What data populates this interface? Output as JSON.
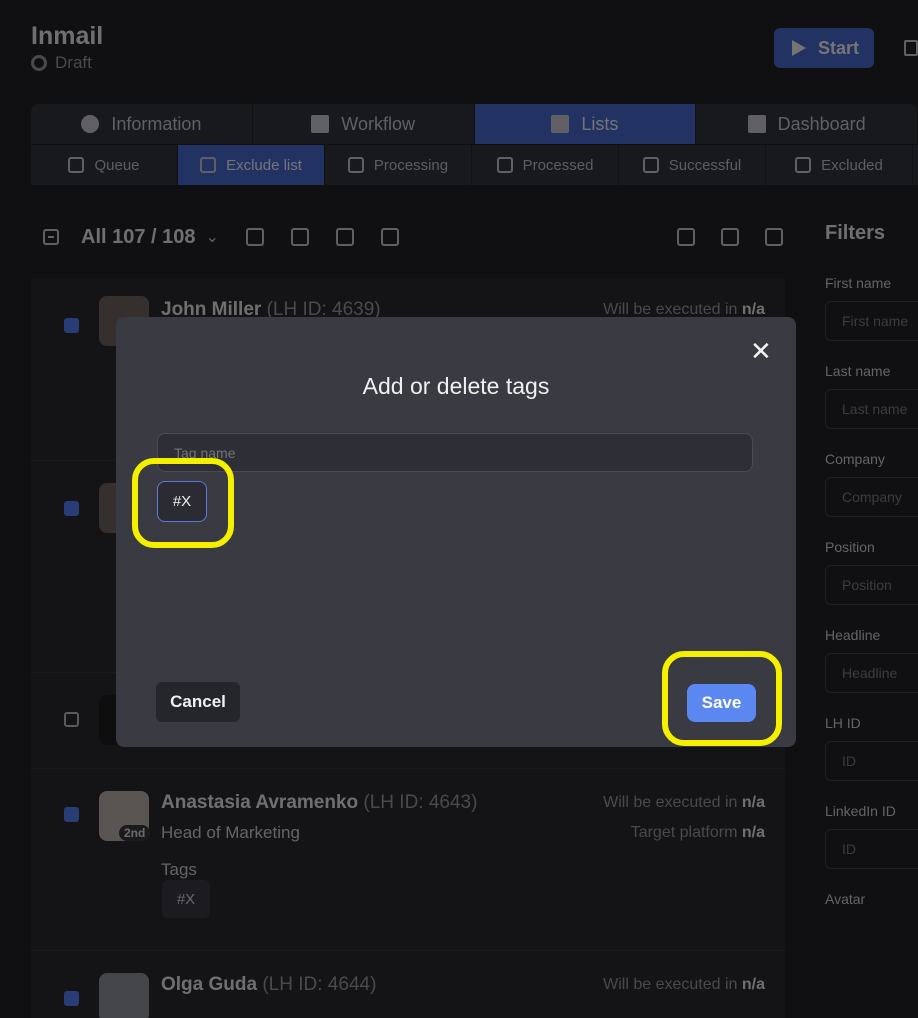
{
  "header": {
    "title": "Inmail",
    "status": "Draft",
    "start_label": "Start"
  },
  "tabs": [
    {
      "label": "Information",
      "icon": "info-icon",
      "active": false
    },
    {
      "label": "Workflow",
      "icon": "workflow-icon",
      "active": false
    },
    {
      "label": "Lists",
      "icon": "list-icon",
      "active": true
    },
    {
      "label": "Dashboard",
      "icon": "dashboard-icon",
      "active": false
    }
  ],
  "subtabs": [
    {
      "label": "Queue",
      "icon": "queue-icon",
      "active": false
    },
    {
      "label": "Exclude list",
      "icon": "ban-icon",
      "active": true
    },
    {
      "label": "Processing",
      "icon": "refresh-icon",
      "active": false
    },
    {
      "label": "Processed",
      "icon": "flag-icon",
      "active": false
    },
    {
      "label": "Successful",
      "icon": "check-icon",
      "active": false
    },
    {
      "label": "Excluded",
      "icon": "user-x-icon",
      "active": false
    }
  ],
  "toolbar": {
    "count_label": "All 107 / 108"
  },
  "filters": {
    "title": "Filters",
    "fields": [
      {
        "label": "First name",
        "placeholder": "First name"
      },
      {
        "label": "Last name",
        "placeholder": "Last name"
      },
      {
        "label": "Company",
        "placeholder": "Company"
      },
      {
        "label": "Position",
        "placeholder": "Position"
      },
      {
        "label": "Headline",
        "placeholder": "Headline"
      },
      {
        "label": "LH ID",
        "placeholder": "ID"
      },
      {
        "label": "LinkedIn ID",
        "placeholder": "ID"
      },
      {
        "label": "Avatar",
        "placeholder": ""
      }
    ]
  },
  "rows": [
    {
      "name": "John Miller",
      "lhid": "(LH ID: 4639)",
      "exec_label": "Will be executed in",
      "exec_value": "n/a"
    },
    {
      "name": "Anastasia Avramenko",
      "lhid": "(LH ID: 4643)",
      "exec_label": "Will be executed in",
      "exec_value": "n/a",
      "headline": "Head of Marketing",
      "platform_label": "Target platform",
      "platform_value": "n/a",
      "degree": "2nd",
      "tags_label": "Tags",
      "tag": "#X"
    },
    {
      "name": "Olga Guda",
      "lhid": "(LH ID: 4644)",
      "exec_label": "Will be executed in",
      "exec_value": "n/a"
    }
  ],
  "modal": {
    "title": "Add or delete tags",
    "input_placeholder": "Tag name",
    "tag": "#X",
    "cancel_label": "Cancel",
    "save_label": "Save"
  },
  "colors": {
    "accent": "#3a63d4",
    "save": "#5b87f0",
    "highlight": "#f5f000"
  }
}
